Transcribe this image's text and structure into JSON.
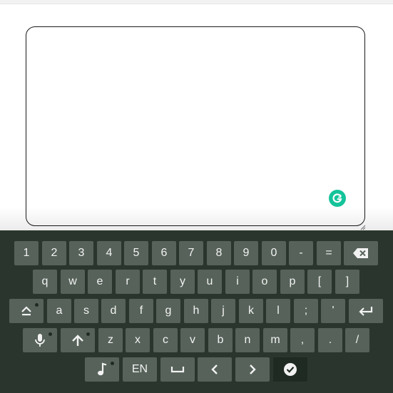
{
  "keyboard": {
    "row1": [
      "1",
      "2",
      "3",
      "4",
      "5",
      "6",
      "7",
      "8",
      "9",
      "0",
      "-",
      "="
    ],
    "row2": [
      "q",
      "w",
      "e",
      "r",
      "t",
      "y",
      "u",
      "i",
      "o",
      "p",
      "[",
      "]"
    ],
    "row3": [
      "a",
      "s",
      "d",
      "f",
      "g",
      "h",
      "j",
      "k",
      "l",
      ";",
      "'"
    ],
    "row4": [
      "z",
      "x",
      "c",
      "v",
      "b",
      "n",
      "m",
      ",",
      ".",
      "/"
    ],
    "lang_label": "EN"
  },
  "icons": {
    "backspace": "backspace-icon",
    "caps": "caps-lock-icon",
    "enter": "enter-icon",
    "mic": "microphone-icon",
    "shift": "shift-arrow-icon",
    "emoji": "music-note-icon",
    "space": "space-bar-icon",
    "left": "chevron-left-icon",
    "right": "chevron-right-icon",
    "done": "checkmark-icon",
    "grammarly": "grammarly-icon"
  },
  "colors": {
    "keyboard_bg": "#2a362d",
    "key_bg": "#56625a",
    "key_dark": "#1f2a22",
    "grammarly": "#15c39a"
  }
}
